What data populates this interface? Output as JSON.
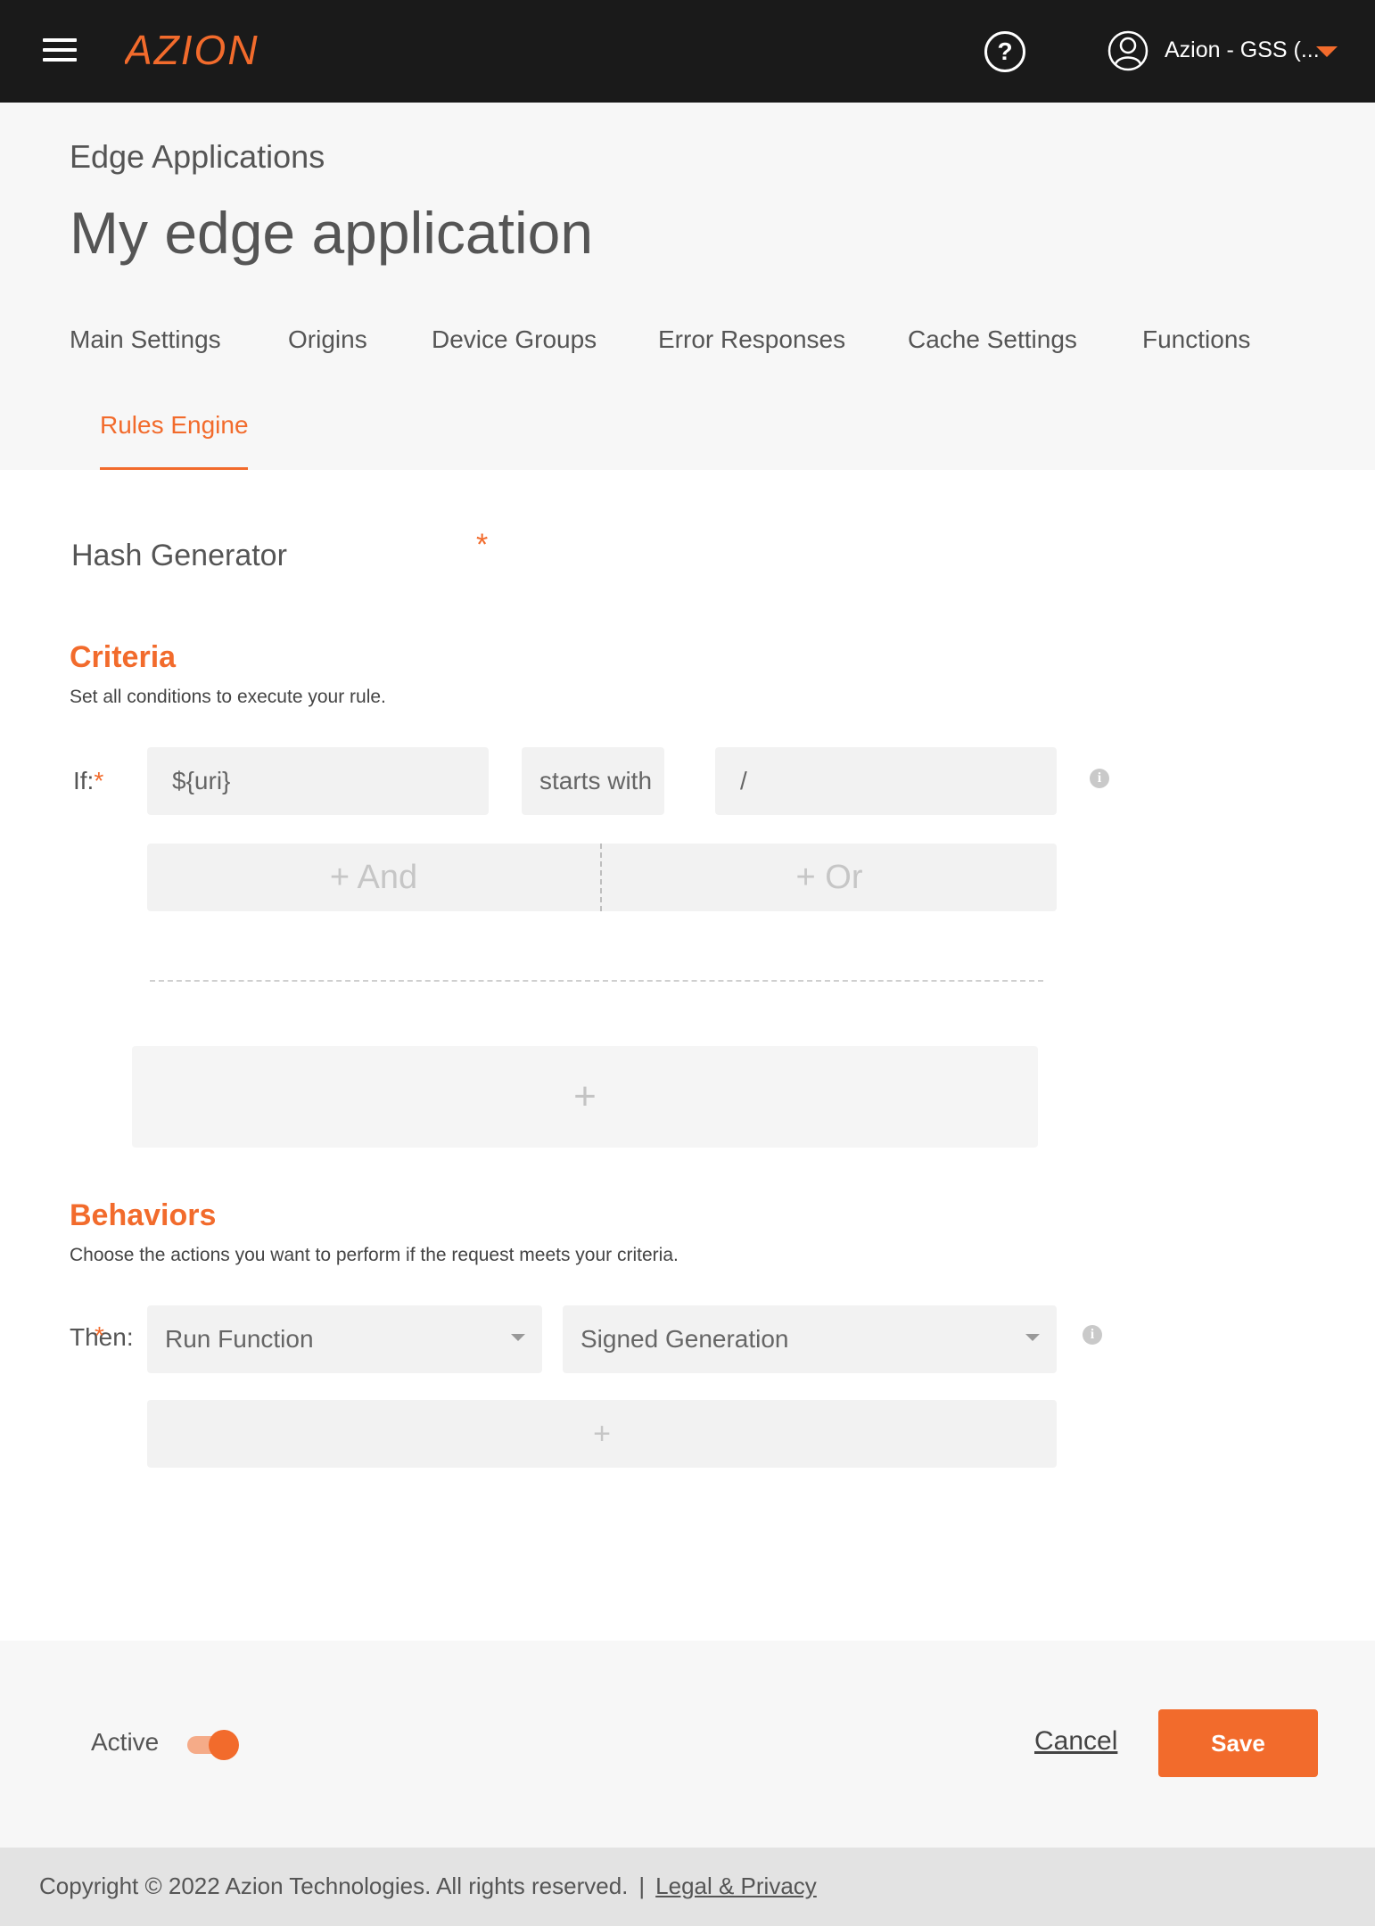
{
  "topbar": {
    "logo_text": "AZION",
    "help_glyph": "?",
    "account_name": "Azion - GSS (...",
    "accent_color": "#f26b2c"
  },
  "header": {
    "breadcrumb": "Edge Applications",
    "title": "My edge application",
    "tabs": [
      {
        "label": "Main Settings",
        "active": false
      },
      {
        "label": "Origins",
        "active": false
      },
      {
        "label": "Device Groups",
        "active": false
      },
      {
        "label": "Error Responses",
        "active": false
      },
      {
        "label": "Cache Settings",
        "active": false
      },
      {
        "label": "Functions",
        "active": false
      },
      {
        "label": "Rules Engine",
        "active": true
      }
    ]
  },
  "rule": {
    "name": "Hash Generator",
    "required_mark": "*"
  },
  "criteria": {
    "title": "Criteria",
    "description": "Set all conditions to execute your rule.",
    "if_label": "If:",
    "variable": "${uri}",
    "operator": "starts with",
    "value": "/",
    "and_label": "+ And",
    "or_label": "+ Or",
    "add_label": "+"
  },
  "behaviors": {
    "title": "Behaviors",
    "description": "Choose the actions you want to perform if the request meets your criteria.",
    "then_label": "Then:",
    "behavior": "Run Function",
    "function": "Signed Generation",
    "add_label": "+"
  },
  "footer": {
    "active_label": "Active",
    "active_on": true,
    "cancel_label": "Cancel",
    "save_label": "Save",
    "copyright": "Copyright © 2022 Azion Technologies. All rights reserved.",
    "separator": "|",
    "legal_label": "Legal & Privacy"
  }
}
